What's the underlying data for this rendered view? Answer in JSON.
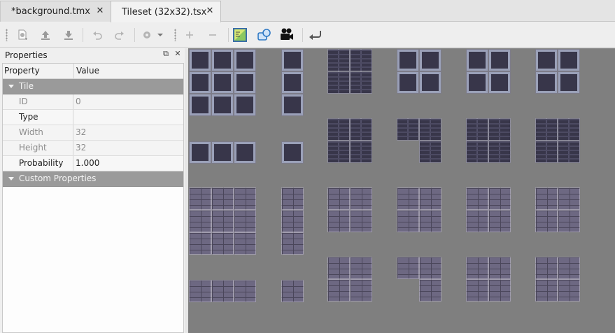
{
  "tabs": [
    {
      "label": "*background.tmx"
    },
    {
      "label": "Tileset (32x32).tsx"
    }
  ],
  "toolbar": {
    "icons": [
      "new-icon",
      "upload-icon",
      "download-icon",
      "undo-icon",
      "redo-icon",
      "gear-icon",
      "chevron-down-icon",
      "add-icon",
      "remove-icon",
      "terrain-icon",
      "shapes-icon",
      "camera-icon",
      "return-icon"
    ]
  },
  "properties": {
    "title": "Properties",
    "columns": {
      "property": "Property",
      "value": "Value"
    },
    "groups": {
      "tile": "Tile",
      "custom": "Custom Properties"
    },
    "rows": [
      {
        "name": "ID",
        "value": "0"
      },
      {
        "name": "Type",
        "value": ""
      },
      {
        "name": "Width",
        "value": "32"
      },
      {
        "name": "Height",
        "value": "32"
      },
      {
        "name": "Probability",
        "value": "1.000"
      }
    ]
  },
  "colors": {
    "tileview_bg": "#7f7f7f",
    "group_bg": "#9a9a9a",
    "tile_dark": "#38364a",
    "tile_light": "#6d6882",
    "tile_rim": "#9aa0b8"
  }
}
